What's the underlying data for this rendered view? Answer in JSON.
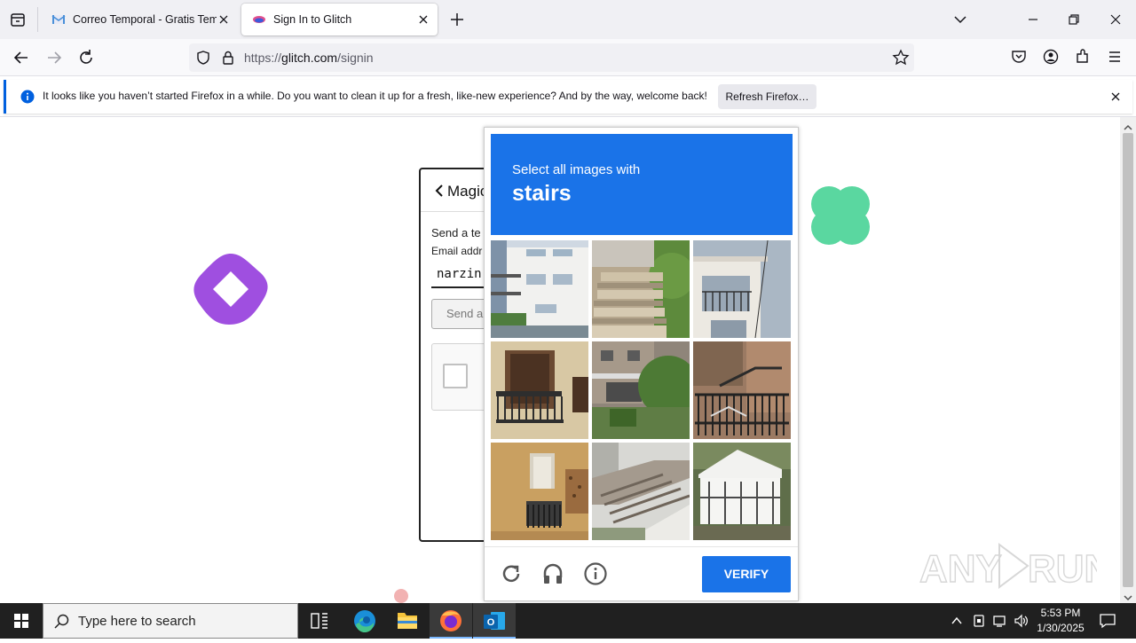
{
  "browser": {
    "tabs": [
      {
        "label": "Correo Temporal - Gratis Temp",
        "active": false
      },
      {
        "label": "Sign In to Glitch",
        "active": true
      }
    ],
    "url": {
      "prefix": "https://",
      "domain": "glitch.com",
      "path": "/signin"
    },
    "notification": {
      "message": "It looks like you haven’t started Firefox in a while. Do you want to clean it up for a fresh, like-new experience? And by the way, welcome back!",
      "button_label": "Refresh Firefox…"
    }
  },
  "signin": {
    "title": "Magic",
    "description": "Send a te",
    "email_label": "Email addr",
    "email_value": "narzin",
    "send_button_label": "Send a"
  },
  "captcha": {
    "instruction": "Select all images with",
    "target": "stairs",
    "verify_label": "VERIFY",
    "header_color": "#1a73e8"
  },
  "watermark": "ANY RUN",
  "taskbar": {
    "search_placeholder": "Type here to search",
    "time": "5:53 PM",
    "date": "1/30/2025"
  },
  "colors": {
    "accent": "#1a73e8",
    "glitch_purple": "#9f4fe0",
    "glitch_green": "#5ad7a0"
  }
}
